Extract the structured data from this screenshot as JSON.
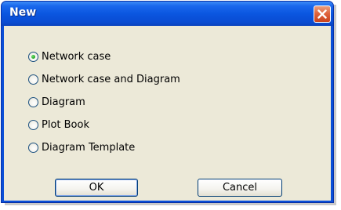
{
  "window": {
    "title": "New"
  },
  "options": [
    {
      "label": "Network case",
      "checked": true
    },
    {
      "label": "Network case and Diagram",
      "checked": false
    },
    {
      "label": "Diagram",
      "checked": false
    },
    {
      "label": "Plot Book",
      "checked": false
    },
    {
      "label": "Diagram Template",
      "checked": false
    }
  ],
  "buttons": {
    "ok_label": "OK",
    "cancel_label": "Cancel"
  },
  "icons": {
    "close": "close-icon"
  },
  "colors": {
    "titlebar": "#0a4fd8",
    "client_background": "#ece9d8",
    "close_button": "#e0643d",
    "radio_selected": "#21a121"
  }
}
